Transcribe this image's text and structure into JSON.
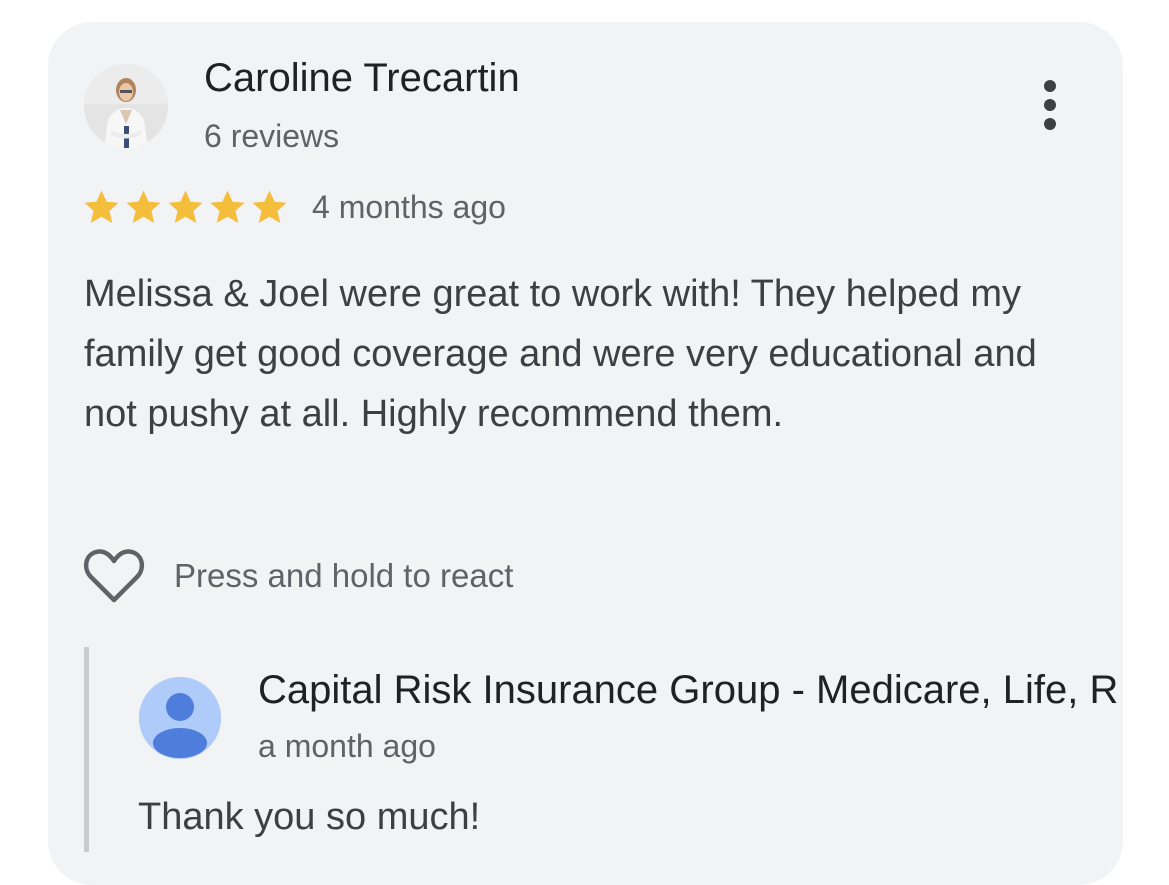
{
  "review": {
    "reviewer_name": "Caroline Trecartin",
    "review_count": "6 reviews",
    "rating": 5,
    "rating_max": 5,
    "date": "4 months ago",
    "text": "Melissa & Joel were great to work with! They helped my family get good coverage and were very educational and not pushy at all. Highly recommend them.",
    "react_label": "Press and hold to react",
    "more_icon": "more-vert-icon",
    "react_icon": "heart-outline-icon"
  },
  "owner_reply": {
    "name": "Capital Risk Insurance Group - Medicare, Life, R",
    "date": "a month ago",
    "text": "Thank you so much!",
    "avatar_icon": "default-person-icon"
  },
  "colors": {
    "card_background": "#f1f3f5",
    "star": "#f4be3c",
    "owner_avatar_bg": "#aecbfa",
    "owner_avatar_fg": "#4f7ddb"
  }
}
